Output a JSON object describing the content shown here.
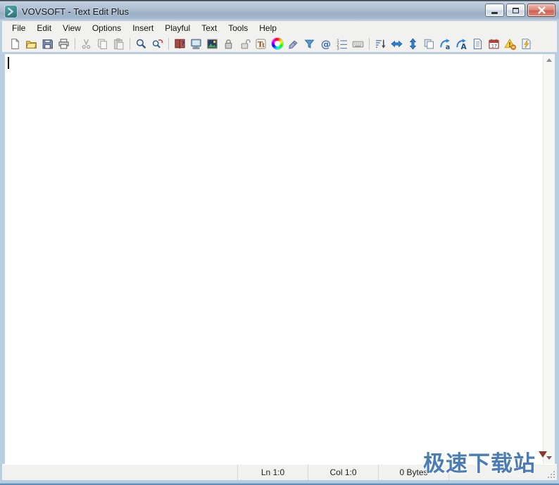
{
  "window": {
    "title": "VOVSOFT - Text Edit Plus",
    "app_icon": "text-edit-plus-app-icon",
    "controls": [
      {
        "icon": "minimize-icon"
      },
      {
        "icon": "maximize-icon"
      },
      {
        "icon": "close-icon"
      }
    ]
  },
  "menu": {
    "items": [
      "File",
      "Edit",
      "View",
      "Options",
      "Insert",
      "Playful",
      "Text",
      "Tools",
      "Help"
    ]
  },
  "toolbar": {
    "items": [
      {
        "icon": "new-file-icon"
      },
      {
        "icon": "open-folder-icon"
      },
      {
        "icon": "save-icon"
      },
      {
        "icon": "print-icon"
      },
      {
        "separator": true
      },
      {
        "icon": "cut-icon",
        "disabled": true
      },
      {
        "icon": "copy-icon",
        "disabled": true
      },
      {
        "icon": "paste-icon",
        "disabled": true
      },
      {
        "separator": true
      },
      {
        "icon": "find-icon"
      },
      {
        "icon": "find-replace-icon"
      },
      {
        "separator": true
      },
      {
        "icon": "help-book-icon"
      },
      {
        "icon": "monitor-icon"
      },
      {
        "icon": "image-icon"
      },
      {
        "icon": "lock-icon"
      },
      {
        "icon": "unlock-icon"
      },
      {
        "icon": "font-icon"
      },
      {
        "icon": "color-wheel-icon"
      },
      {
        "icon": "eraser-icon"
      },
      {
        "icon": "filter-icon"
      },
      {
        "icon": "email-at-icon"
      },
      {
        "icon": "numbered-list-icon"
      },
      {
        "icon": "keyboard-icon"
      },
      {
        "separator": true
      },
      {
        "icon": "sort-lines-icon"
      },
      {
        "icon": "arrows-horizontal-icon"
      },
      {
        "icon": "arrows-vertical-icon"
      },
      {
        "icon": "duplicate-pages-icon"
      },
      {
        "icon": "lowercase-icon"
      },
      {
        "icon": "uppercase-icon"
      },
      {
        "icon": "document-lines-icon"
      },
      {
        "icon": "calendar-icon"
      },
      {
        "icon": "warning-icon"
      },
      {
        "icon": "flash-icon"
      }
    ]
  },
  "editor": {
    "content": "",
    "caret_visible": true
  },
  "scrollbar": {
    "up_icon": "scroll-up-icon",
    "down_icon": "scroll-down-icon"
  },
  "status_bar": {
    "line": "Ln 1:0",
    "column": "Col 1:0",
    "size": "0 Bytes"
  },
  "watermark": {
    "text": "极速下载站",
    "color": "#4a7cb5"
  },
  "colors": {
    "frame": "#b9cee0",
    "titlebar_top": "#c3d1e0",
    "titlebar_bottom": "#9ab0c7",
    "bars_background": "#f1f1ef",
    "close_button": "#ce6254",
    "editor_background": "#ffffff"
  }
}
